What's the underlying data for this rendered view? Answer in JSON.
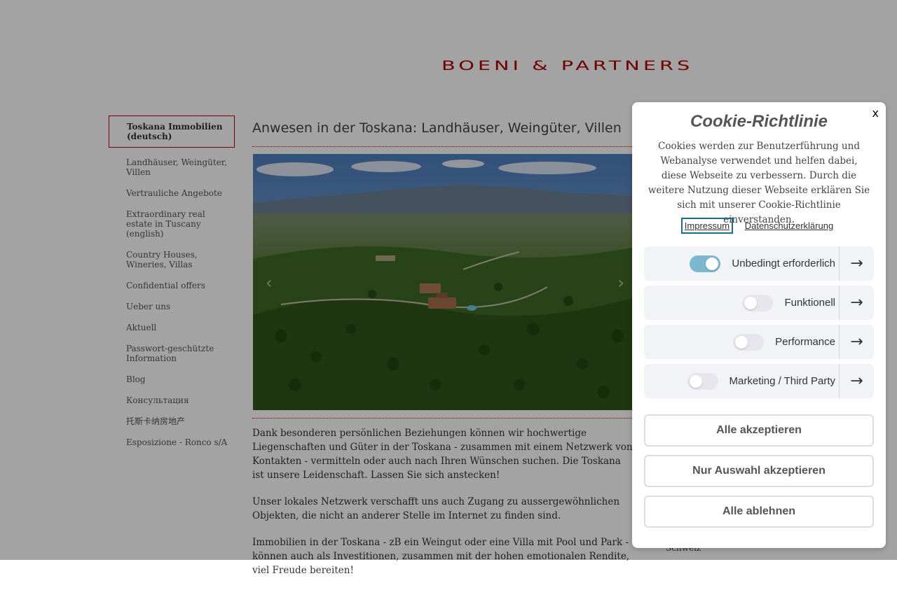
{
  "brand": {
    "logo_text": "BOENI & PARTNERS",
    "accent_color": "#b00000"
  },
  "sidebar": {
    "items": [
      {
        "label": "Toskana Immobilien (deutsch)",
        "active": true
      },
      {
        "label": "Landhäuser, Weingüter, Villen"
      },
      {
        "label": "Vertrauliche Angebote"
      },
      {
        "label": "Extraordinary real estate in Tuscany (english)"
      },
      {
        "label": "Country Houses, Wineries, Villas"
      },
      {
        "label": "Confidential offers"
      },
      {
        "label": "Ueber uns"
      },
      {
        "label": "Aktuell"
      },
      {
        "label": "Passwort-geschützte Information"
      },
      {
        "label": "Blog"
      },
      {
        "label": "Консультация"
      },
      {
        "label": "托斯卡纳房地产"
      },
      {
        "label": "Esposizione - Ronco s/A"
      }
    ]
  },
  "main": {
    "title": "Anwesen in der Toskana: Landhäuser, Weingüter, Villen",
    "slider": {
      "prev_icon": "‹",
      "next_icon": "›"
    },
    "paragraphs": [
      "Dank besonderen persönlichen Beziehungen können wir hochwertige Liegenschaften und Güter in der Toskana - zusammen mit einem Netzwerk von Kontakten - vermitteln oder auch nach Ihren Wünschen suchen. Die Toskana ist unsere Leidenschaft. Lassen Sie sich anstecken!",
      "Unser lokales Netzwerk verschafft uns auch Zugang zu aussergewöhnlichen Objekten, die nicht an anderer Stelle im Internet zu finden sind.",
      "Immobilien in der Toskana - zB ein Weingut oder eine Villa mit Pool und Park - können auch als Investitionen, zusammen mit der hohen emotionalen Rendite, viel Freude bereiten!"
    ],
    "side_peek": "Schweiz"
  },
  "cookie": {
    "close_label": "x",
    "title": "Cookie-Richtlinie",
    "description": "Cookies werden zur Benutzerführung und Webanalyse verwendet und helfen dabei, diese Webseite zu verbessern. Durch die weitere Nutzung dieser Webseite erklären Sie sich mit unserer Cookie-Richtlinie einverstanden.",
    "links": {
      "impressum": "Impressum",
      "privacy": "Datenschutzerklärung"
    },
    "categories": [
      {
        "label": "Unbedingt erforderlich",
        "enabled": true
      },
      {
        "label": "Funktionell",
        "enabled": false
      },
      {
        "label": "Performance",
        "enabled": false
      },
      {
        "label": "Marketing / Third Party",
        "enabled": false
      }
    ],
    "arrow_icon": "→",
    "buttons": {
      "accept_all": "Alle akzeptieren",
      "accept_selection": "Nur Auswahl akzeptieren",
      "reject_all": "Alle ablehnen"
    },
    "toggle_on_color": "#7bb8d0"
  }
}
